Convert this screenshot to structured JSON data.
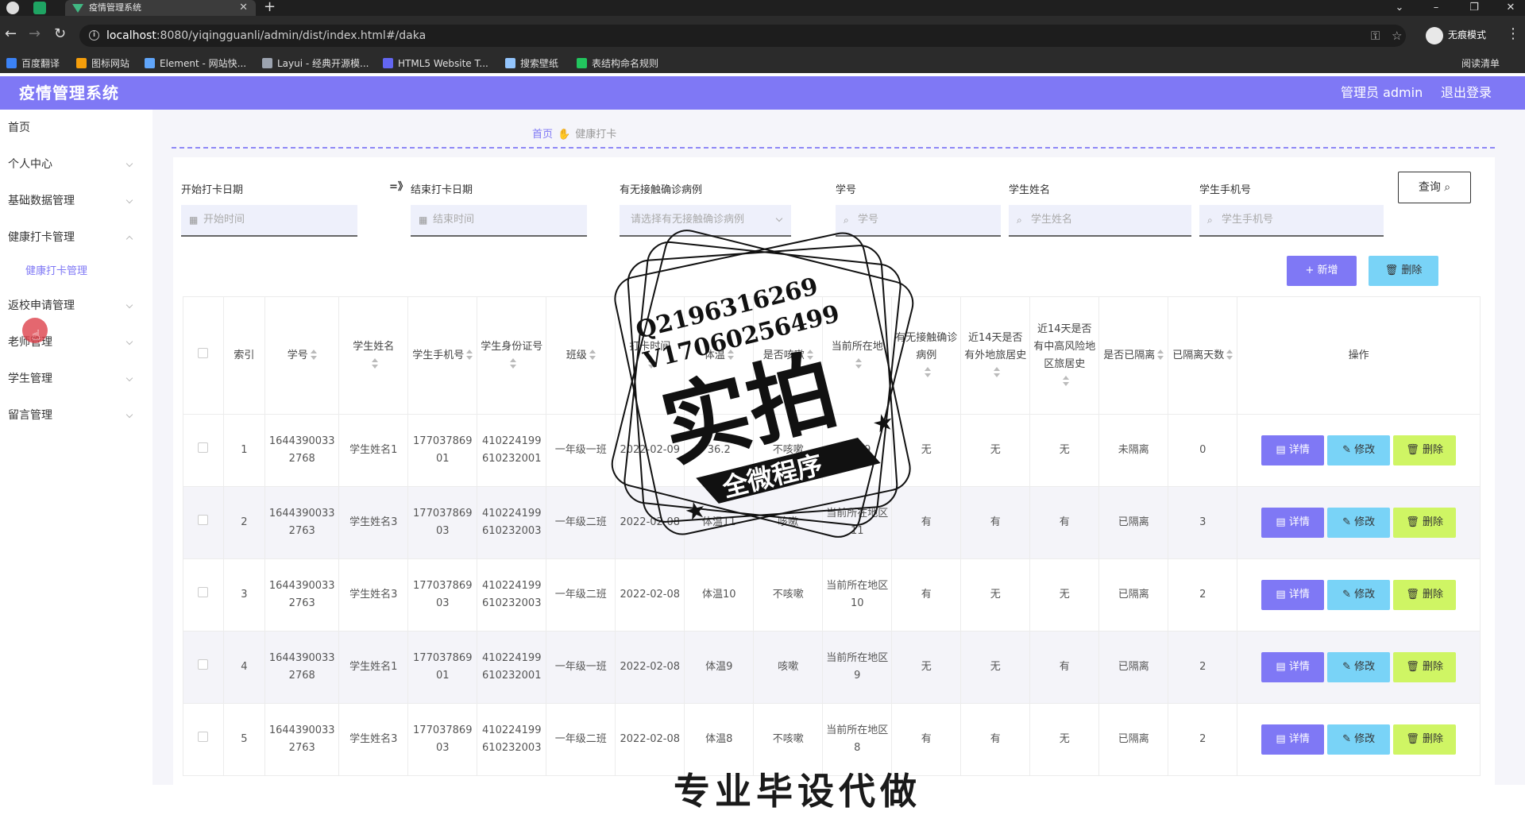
{
  "browser": {
    "tab_title": "疫情管理系统",
    "url_host": "localhost",
    "url_rest": ":8080/yiqingguanli/admin/dist/index.html#/daka",
    "incognito_label": "无痕模式",
    "reading_list": "阅读清单",
    "bookmarks": [
      {
        "label": "百度翻译",
        "color": "#3b82f6"
      },
      {
        "label": "图标网站",
        "color": "#f59e0b"
      },
      {
        "label": "Element - 网站快...",
        "color": "#60a5fa"
      },
      {
        "label": "Layui - 经典开源模...",
        "color": "#9ca3af"
      },
      {
        "label": "HTML5 Website T...",
        "color": "#6366f1"
      },
      {
        "label": "搜索壁纸",
        "color": "#93c5fd"
      },
      {
        "label": "表结构命名规则",
        "color": "#22c55e"
      }
    ]
  },
  "header": {
    "title": "疫情管理系统",
    "user": "管理员 admin",
    "logout": "退出登录"
  },
  "sidebar": {
    "items": [
      {
        "label": "首页",
        "has_chevron": false
      },
      {
        "label": "个人中心",
        "has_chevron": true
      },
      {
        "label": "基础数据管理",
        "has_chevron": true
      },
      {
        "label": "健康打卡管理",
        "has_chevron": true
      },
      {
        "label": "返校申请管理",
        "has_chevron": true
      },
      {
        "label": "老师管理",
        "has_chevron": true
      },
      {
        "label": "学生管理",
        "has_chevron": true
      },
      {
        "label": "留言管理",
        "has_chevron": true
      }
    ],
    "active_sub": "健康打卡管理"
  },
  "breadcrumb": {
    "home": "首页",
    "current": "健康打卡"
  },
  "search": {
    "start_label": "开始打卡日期",
    "start_placeholder": "开始时间",
    "arrow": "=》",
    "end_label": "结束打卡日期",
    "end_placeholder": "结束时间",
    "contact_label": "有无接触确诊病例",
    "contact_placeholder": "请选择有无接触确诊病例",
    "xuehao_label": "学号",
    "xuehao_placeholder": "学号",
    "name_label": "学生姓名",
    "name_placeholder": "学生姓名",
    "phone_label": "学生手机号",
    "phone_placeholder": "学生手机号",
    "query_button": "查询"
  },
  "actions": {
    "add": "+ 新增",
    "delete": "删除"
  },
  "table": {
    "headers": [
      "索引",
      "学号",
      "学生姓名",
      "学生手机号",
      "学生身份证号",
      "班级",
      "打卡时间",
      "体温",
      "是否咳嗽",
      "当前所在地",
      "有无接触确诊病例",
      "近14天是否有外地旅居史",
      "近14天是否有中高风险地区旅居史",
      "是否已隔离",
      "已隔离天数",
      "操作"
    ],
    "rows": [
      [
        "1",
        "16443900332768",
        "学生姓名1",
        "17703786901",
        "410224199610232001",
        "一年级一班",
        "2022-02-09",
        "36.2",
        "不咳嗽",
        "地区9",
        "无",
        "无",
        "无",
        "未隔离",
        "0"
      ],
      [
        "2",
        "16443900332763",
        "学生姓名3",
        "17703786903",
        "410224199610232003",
        "一年级二班",
        "2022-02-08",
        "体温11",
        "咳嗽",
        "当前所在地区11",
        "有",
        "有",
        "有",
        "已隔离",
        "3"
      ],
      [
        "3",
        "16443900332763",
        "学生姓名3",
        "17703786903",
        "410224199610232003",
        "一年级二班",
        "2022-02-08",
        "体温10",
        "不咳嗽",
        "当前所在地区10",
        "有",
        "无",
        "无",
        "已隔离",
        "2"
      ],
      [
        "4",
        "16443900332768",
        "学生姓名1",
        "17703786901",
        "410224199610232001",
        "一年级一班",
        "2022-02-08",
        "体温9",
        "咳嗽",
        "当前所在地区9",
        "无",
        "无",
        "有",
        "已隔离",
        "2"
      ],
      [
        "5",
        "16443900332763",
        "学生姓名3",
        "17703786903",
        "410224199610232003",
        "一年级二班",
        "2022-02-08",
        "体温8",
        "不咳嗽",
        "当前所在地区8",
        "有",
        "有",
        "无",
        "已隔离",
        "2"
      ]
    ],
    "row_actions": {
      "detail": "详情",
      "edit": "修改",
      "delete": "删除"
    }
  },
  "watermark": {
    "qq": "Q2196316269",
    "phone": "V17060256499",
    "big": "实拍",
    "ribbon": "全微程序",
    "bottom": "专业毕设代做"
  },
  "colors": {
    "primary": "#7f78f5",
    "info": "#79d3f7",
    "danger": "#cff564"
  }
}
